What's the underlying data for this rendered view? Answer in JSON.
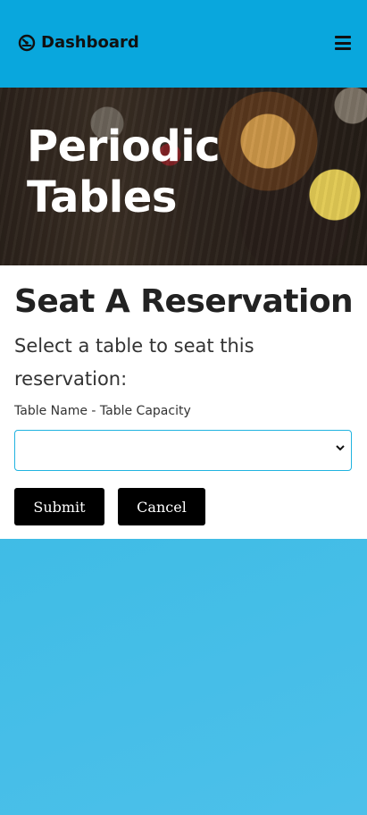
{
  "navbar": {
    "brand_label": "Dashboard",
    "brand_icon": "dashboard-gauge-icon",
    "menu_icon": "hamburger-menu-icon",
    "background": "#09a7dd"
  },
  "hero": {
    "title": "Periodic Tables"
  },
  "form": {
    "heading": "Seat A Reservation",
    "instruction": "Select a table to seat this reservation:",
    "field_label": "Table Name - Table Capacity",
    "select_value": "",
    "submit_label": "Submit",
    "cancel_label": "Cancel"
  },
  "colors": {
    "accent": "#09a7dd",
    "button": "#000000",
    "page_background": "#3cbbe4"
  }
}
